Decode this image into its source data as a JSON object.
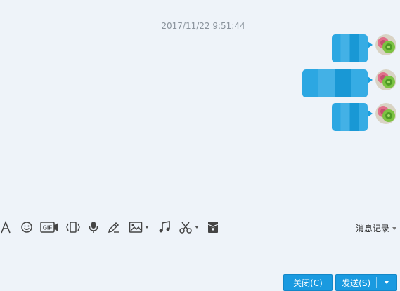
{
  "chat": {
    "timestamp": "2017/11/22 9:51:44",
    "messages": [
      {
        "sender": "self",
        "content": ""
      },
      {
        "sender": "self",
        "content": ""
      },
      {
        "sender": "self",
        "content": ""
      }
    ]
  },
  "toolbar": {
    "tools": [
      "font-icon",
      "emoji-icon",
      "gif-icon",
      "screen-shake-icon",
      "voice-icon",
      "handwriting-icon",
      "image-icon",
      "music-icon",
      "screenshot-icon",
      "red-packet-icon"
    ],
    "gif_label": "GIF",
    "history_label": "消息记录"
  },
  "buttons": {
    "close_label": "关闭(C)",
    "send_label": "发送(S)"
  },
  "colors": {
    "accent": "#1a9ae0",
    "background": "#eef3f9",
    "bubble": "#1aa0e0"
  }
}
